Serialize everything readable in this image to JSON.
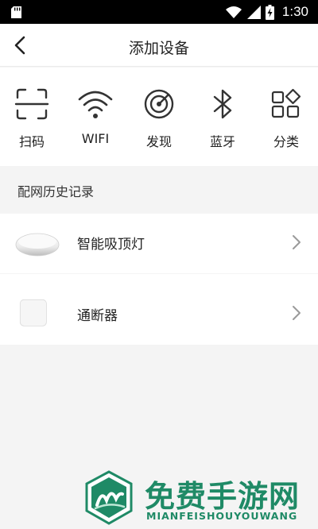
{
  "status_bar": {
    "time": "1:30"
  },
  "header": {
    "title": "添加设备"
  },
  "tools": [
    {
      "label": "扫码",
      "icon": "scan-icon"
    },
    {
      "label": "WIFI",
      "icon": "wifi-icon"
    },
    {
      "label": "发现",
      "icon": "radar-icon"
    },
    {
      "label": "蓝牙",
      "icon": "bluetooth-icon"
    },
    {
      "label": "分类",
      "icon": "category-icon"
    }
  ],
  "history": {
    "title": "配网历史记录",
    "devices": [
      {
        "name": "智能吸顶灯",
        "icon": "ceiling-light-icon"
      },
      {
        "name": "通断器",
        "icon": "switch-module-icon"
      }
    ]
  },
  "watermark": {
    "title": "免费手游网",
    "subtitle": "MIANFEISHOUYOUWANG"
  },
  "colors": {
    "accent": "#1f8a66",
    "background": "#f4f4f4",
    "status_bar": "#000000"
  }
}
